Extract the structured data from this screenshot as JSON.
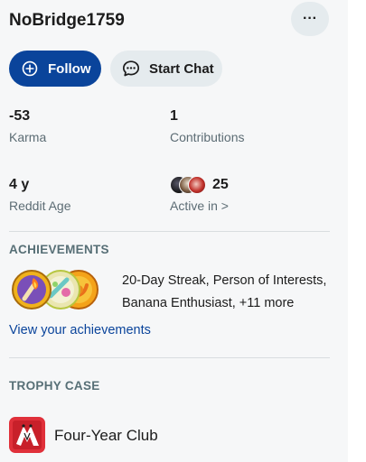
{
  "profile": {
    "username": "NoBridge1759",
    "more_icon": "ellipsis-icon",
    "more_label": "···"
  },
  "actions": {
    "follow_label": "Follow",
    "follow_icon": "plus-circle-icon",
    "chat_label": "Start Chat",
    "chat_icon": "chat-bubble-icon"
  },
  "stats": {
    "karma_value": "-53",
    "karma_label": "Karma",
    "contributions_value": "1",
    "contributions_label": "Contributions",
    "age_value": "4 y",
    "age_label": "Reddit Age",
    "active_value": "25",
    "active_label": "Active in >"
  },
  "achievements": {
    "title": "ACHIEVEMENTS",
    "summary_line1": "20-Day Streak, Person of Interests,",
    "summary_line2": "Banana Enthusiast, +11 more",
    "link": "View your achievements"
  },
  "trophy_case": {
    "title": "TROPHY CASE",
    "trophy_name": "Four-Year Club"
  },
  "colors": {
    "follow_bg": "#0a449b",
    "chip_bg": "#e5ebee",
    "panel_bg": "#f6f7f8",
    "link": "#0a449b",
    "trophy_red": "#e0303a"
  }
}
